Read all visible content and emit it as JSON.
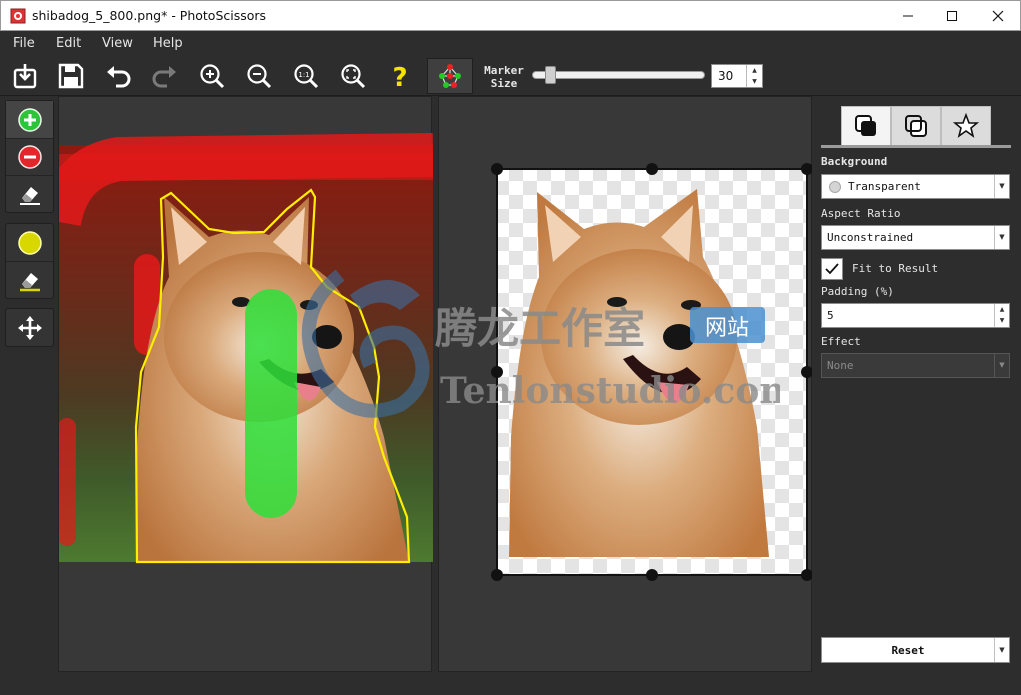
{
  "window": {
    "title": "shibadog_5_800.png* - PhotoScissors",
    "minimize_icon": "minimize-icon",
    "maximize_icon": "maximize-icon",
    "close_icon": "close-icon"
  },
  "menu": {
    "items": [
      "File",
      "Edit",
      "View",
      "Help"
    ]
  },
  "toolbar": {
    "marker_size_line1": "Marker",
    "marker_size_line2": "Size",
    "marker_size_value": "30",
    "marker_size_fraction": 0.08,
    "buttons": [
      "open-icon",
      "save-icon",
      "undo-icon",
      "redo-icon",
      "zoom-in-icon",
      "zoom-out-icon",
      "zoom-actual-icon",
      "zoom-fit-icon",
      "help-icon",
      "auto-segment-icon"
    ]
  },
  "left_tools": [
    "foreground-marker-icon",
    "background-marker-icon",
    "eraser-icon",
    "color-marker-icon",
    "color-eraser-icon",
    "move-icon"
  ],
  "watermark": {
    "cn": "腾龙工作室",
    "badge": "网站",
    "url": "Tenlonstudio.com"
  },
  "panel": {
    "tabs": [
      "background-tab-icon",
      "foreground-tab-icon",
      "effects-tab-icon"
    ],
    "background_label": "Background",
    "background_value": "Transparent",
    "aspect_label": "Aspect Ratio",
    "aspect_value": "Unconstrained",
    "fit_label": "Fit to Result",
    "fit_checked": true,
    "padding_label": "Padding (%)",
    "padding_value": "5",
    "effect_label": "Effect",
    "effect_value": "None",
    "reset_label": "Reset"
  },
  "colors": {
    "foreground_marker": "#2ecc40",
    "background_marker": "#e02020",
    "selection_outline": "#ffee00",
    "color_marker": "#d8d800"
  }
}
